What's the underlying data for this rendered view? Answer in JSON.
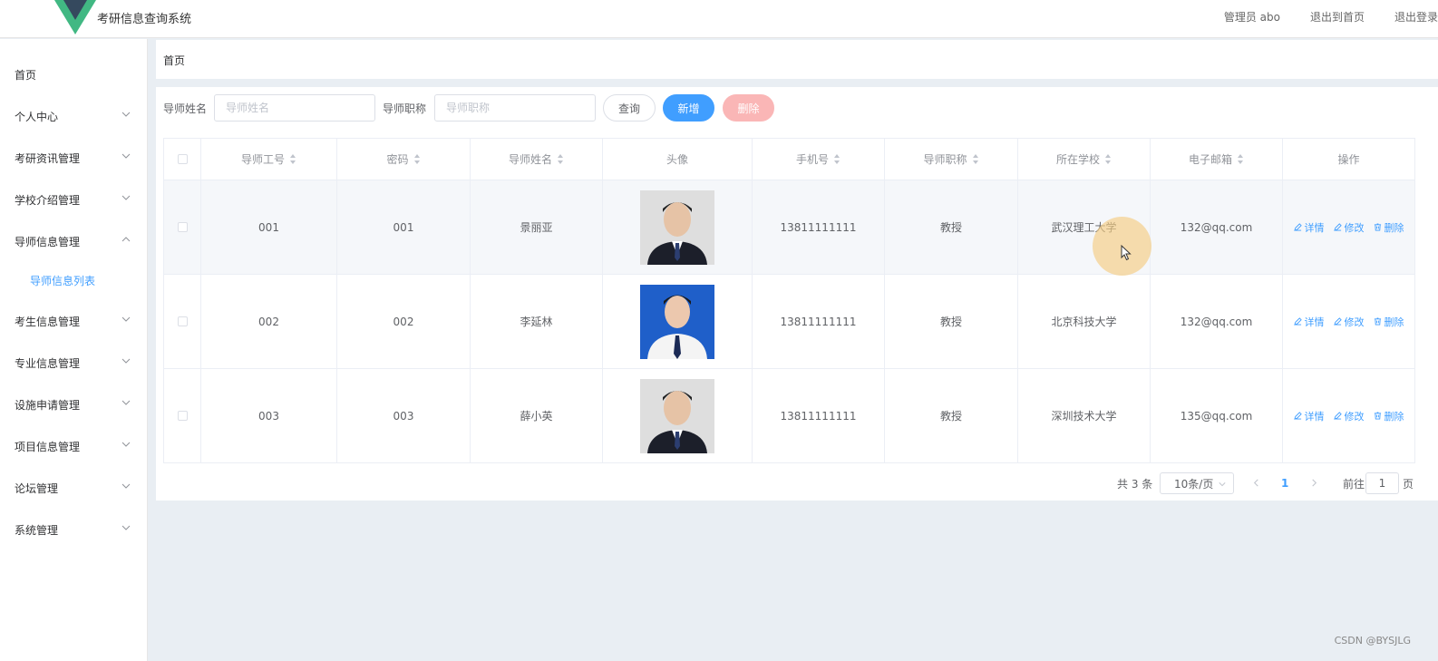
{
  "header": {
    "app_title": "考研信息查询系统",
    "links": [
      "管理员 abo",
      "退出到首页",
      "退出登录"
    ]
  },
  "sidebar": {
    "items": [
      {
        "label": "首页",
        "expandable": false
      },
      {
        "label": "个人中心",
        "expandable": true
      },
      {
        "label": "考研资讯管理",
        "expandable": true
      },
      {
        "label": "学校介绍管理",
        "expandable": true
      },
      {
        "label": "导师信息管理",
        "expandable": true,
        "expanded": true
      },
      {
        "label": "考生信息管理",
        "expandable": true
      },
      {
        "label": "专业信息管理",
        "expandable": true
      },
      {
        "label": "设施申请管理",
        "expandable": true
      },
      {
        "label": "项目信息管理",
        "expandable": true
      },
      {
        "label": "论坛管理",
        "expandable": true
      },
      {
        "label": "系统管理",
        "expandable": true
      }
    ],
    "active_subitem": "导师信息列表"
  },
  "breadcrumb": "首页",
  "search": {
    "name_label": "导师姓名",
    "name_placeholder": "导师姓名",
    "title_label": "导师职称",
    "title_placeholder": "导师职称",
    "query_button": "查询",
    "add_button": "新增",
    "delete_button": "删除"
  },
  "table": {
    "columns": [
      "导师工号",
      "密码",
      "导师姓名",
      "头像",
      "手机号",
      "导师职称",
      "所在学校",
      "电子邮箱",
      "操作"
    ],
    "rows": [
      {
        "id": "001",
        "password": "001",
        "name": "景丽亚",
        "phone": "13811111111",
        "title": "教授",
        "school": "武汉理工大学",
        "email": "132@qq.com",
        "avatar_bg": "#dedede"
      },
      {
        "id": "002",
        "password": "002",
        "name": "李延林",
        "phone": "13811111111",
        "title": "教授",
        "school": "北京科技大学",
        "email": "132@qq.com",
        "avatar_bg": "#1f5fc9"
      },
      {
        "id": "003",
        "password": "003",
        "name": "薛小英",
        "phone": "13811111111",
        "title": "教授",
        "school": "深圳技术大学",
        "email": "135@qq.com",
        "avatar_bg": "#dedede"
      }
    ],
    "actions": [
      "详情",
      "修改",
      "删除"
    ]
  },
  "pagination": {
    "total_text": "共 3 条",
    "page_size": "10条/页",
    "current_page": "1",
    "goto_label": "前往",
    "goto_value": "1",
    "page_suffix": "页"
  },
  "watermark": "CSDN @BYSJLG",
  "colors": {
    "primary": "#409eff",
    "danger_disabled": "#fab6b6",
    "logo_green": "#41b883",
    "logo_dark": "#35495e"
  }
}
